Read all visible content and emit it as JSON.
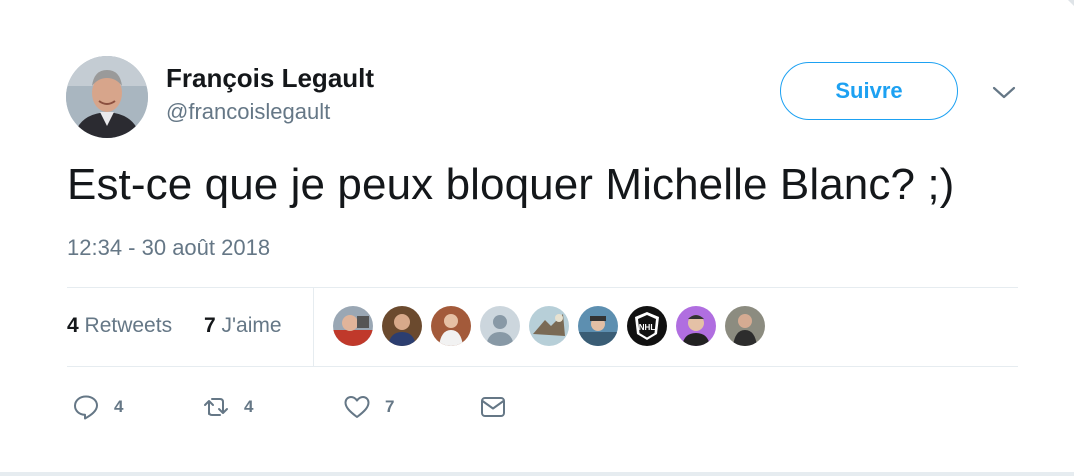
{
  "author": {
    "name": "François Legault",
    "handle": "@francoislegault"
  },
  "follow_button": {
    "label": "Suivre"
  },
  "tweet": {
    "text": "Est-ce que je peux bloquer Michelle Blanc? ;)",
    "timestamp": "12:34 - 30 août 2018"
  },
  "stats": {
    "retweets_count": "4",
    "retweets_label": "Retweets",
    "likes_count": "7",
    "likes_label": "J'aime"
  },
  "actions": {
    "reply_count": "4",
    "retweet_count": "4",
    "like_count": "7"
  },
  "colors": {
    "accent": "#1da1f2",
    "text": "#14171a",
    "muted": "#657786",
    "divider": "#e6ecf0"
  },
  "icons": [
    "chevron-down-icon",
    "reply-icon",
    "retweet-icon",
    "heart-icon",
    "mail-icon"
  ]
}
